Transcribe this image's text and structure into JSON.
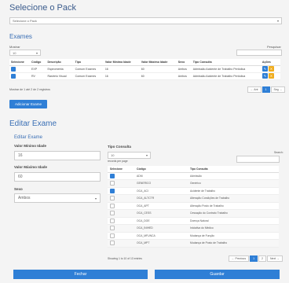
{
  "pack": {
    "title": "Selecione o Pack",
    "select_value": "Selecione o Pack"
  },
  "exames": {
    "title": "Exames",
    "mostrar_label": "Mostrar",
    "page_size": "10",
    "pesquisar_label": "Pesquisar",
    "columns": [
      "Selecione",
      "Código",
      "Descrição",
      "Tipo",
      "Valor Mínimo Idade",
      "Valor Máximo Idade",
      "Sexo",
      "Tipo Consulta",
      "Ações"
    ],
    "rows": [
      {
        "codigo": "EXP",
        "descricao": "Espirometria",
        "tipo": "Comum Exames",
        "min": "16",
        "max": "60",
        "sexo": "Ambos",
        "tipo_consulta": "Admissão Acidente de Trabalho Periódica"
      },
      {
        "codigo": "RV",
        "descricao": "Rastreio Visual",
        "tipo": "Comum Exames",
        "min": "16",
        "max": "60",
        "sexo": "Ambos",
        "tipo_consulta": "Admissão Acidente de Trabalho Periódica"
      }
    ],
    "info": "Mostrar de 1 até 2 de 2 registros",
    "pagination": {
      "prev": "← Ant",
      "current": "1",
      "next": "Seg →"
    },
    "add_button": "Adicionar Exame"
  },
  "editar": {
    "title": "Editar Exame",
    "subtitle": "Editar Exame",
    "min_label": "Valor Mínimo Idade",
    "min_value": "16",
    "max_label": "Valor Máximo Idade",
    "max_value": "60",
    "sexo_label": "Sexo",
    "sexo_value": "Ambos",
    "tipo_consulta_label": "Tipo Consulta",
    "tc_page_size": "10",
    "tc_records_label": "records per page",
    "search_label": "Search:",
    "tc_columns": [
      "Selecione",
      "Código",
      "Tipo Consulta"
    ],
    "tc_rows": [
      {
        "checked": true,
        "codigo": "ADM",
        "tipo": "Admissão"
      },
      {
        "checked": false,
        "codigo": "GENERICO",
        "tipo": "Genérico"
      },
      {
        "checked": true,
        "codigo": "OCA_ACI",
        "tipo": "Acidente de Trabalho"
      },
      {
        "checked": false,
        "codigo": "OCA_ALTCTR",
        "tipo": "Alteração Condições de Trabalho"
      },
      {
        "checked": false,
        "codigo": "OCA_APT",
        "tipo": "Alteração Posto de Trabalho"
      },
      {
        "checked": false,
        "codigo": "OCA_CESS",
        "tipo": "Cessação do Contrato Trabalho"
      },
      {
        "checked": false,
        "codigo": "OCA_DOE",
        "tipo": "Doença Natural"
      },
      {
        "checked": false,
        "codigo": "OCA_INIHED",
        "tipo": "Iniciativa do Médico"
      },
      {
        "checked": false,
        "codigo": "OCA_MFUNCA",
        "tipo": "Mudança de Função"
      },
      {
        "checked": false,
        "codigo": "OCA_MPT",
        "tipo": "Mudança de Posto de Trabalho"
      }
    ],
    "tc_info": "Showing 1 to 10 of 13 entries",
    "tc_pagination": {
      "prev": "← Previous",
      "p1": "1",
      "p2": "2",
      "next": "Next →"
    },
    "fechar_button": "Fechar",
    "guardar_button": "Guardar"
  },
  "colors": {
    "accent": "#2f7fd6",
    "title": "#3a6fb5",
    "edit_action": "#2f7fd6",
    "delete_action": "#f0ad1e"
  }
}
